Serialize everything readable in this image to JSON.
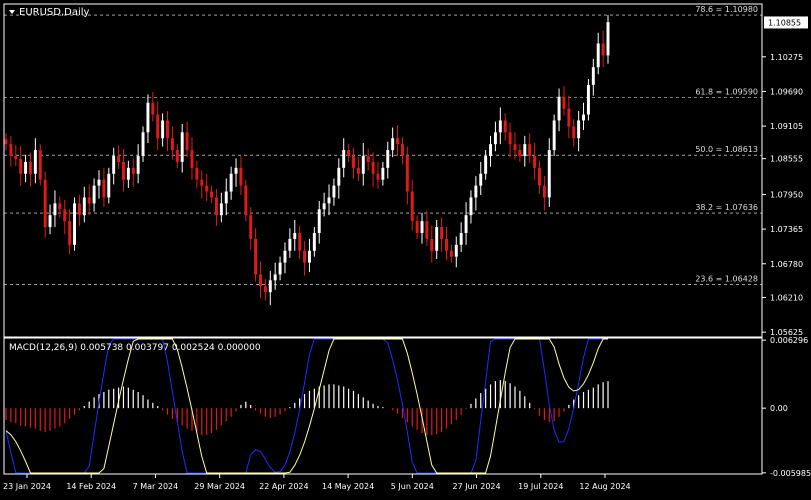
{
  "title": "EURUSD,Daily",
  "indicator_label": "MACD(12,26,9) 0.005738 0.003797 0.002524 0.000000",
  "colors": {
    "background": "#000000",
    "grid": "#ffffff",
    "bull": "#ffffff",
    "bear": "#e01a1a",
    "macd_line": "#1e2cff",
    "signal_line": "#ffff99",
    "hist_pos": "#ffffff",
    "hist_neg": "#e01a1a",
    "price_box_bg": "#ffffff",
    "price_box_fg": "#000000"
  },
  "chart_data": [
    {
      "type": "candlestick",
      "symbol": "EURUSD",
      "timeframe": "Daily",
      "ylim": [
        1.0556,
        1.1115
      ],
      "price_ticks": [
        "1.10275",
        "1.09690",
        "1.09105",
        "1.08555",
        "1.07950",
        "1.07365",
        "1.06780",
        "1.06210",
        "1.05625"
      ],
      "current_price": "1.10855",
      "fib_levels": [
        {
          "label": "78.6 = 1.10980",
          "value": 1.1098
        },
        {
          "label": "61.8 = 1.09590",
          "value": 1.0959
        },
        {
          "label": "50.0 = 1.08613",
          "value": 1.08613
        },
        {
          "label": "38.2 = 1.07636",
          "value": 1.07636
        },
        {
          "label": "23.6 = 1.06428",
          "value": 1.06428
        }
      ],
      "date_ticks": [
        "23 Jan 2024",
        "14 Feb 2024",
        "7 Mar 2024",
        "29 Mar 2024",
        "22 Apr 2024",
        "14 May 2024",
        "5 Jun 2024",
        "27 Jun 2024",
        "19 Jul 2024",
        "12 Aug 2024"
      ],
      "closes": [
        1.088,
        1.086,
        1.0855,
        1.083,
        1.085,
        1.083,
        1.087,
        1.082,
        1.074,
        1.076,
        1.078,
        1.077,
        1.075,
        1.071,
        1.078,
        1.076,
        1.079,
        1.078,
        1.081,
        1.082,
        1.079,
        1.083,
        1.086,
        1.085,
        1.082,
        1.084,
        1.083,
        1.086,
        1.09,
        1.095,
        1.093,
        1.089,
        1.092,
        1.089,
        1.087,
        1.085,
        1.09,
        1.087,
        1.084,
        1.082,
        1.081,
        1.08,
        1.079,
        1.076,
        1.078,
        1.08,
        1.083,
        1.084,
        1.081,
        1.076,
        1.072,
        1.066,
        1.064,
        1.063,
        1.065,
        1.066,
        1.068,
        1.07,
        1.072,
        1.073,
        1.07,
        1.068,
        1.07,
        1.073,
        1.077,
        1.078,
        1.079,
        1.081,
        1.084,
        1.087,
        1.086,
        1.084,
        1.083,
        1.086,
        1.085,
        1.083,
        1.082,
        1.084,
        1.087,
        1.089,
        1.088,
        1.086,
        1.08,
        1.075,
        1.073,
        1.075,
        1.072,
        1.07,
        1.074,
        1.072,
        1.07,
        1.069,
        1.071,
        1.073,
        1.076,
        1.079,
        1.081,
        1.083,
        1.086,
        1.088,
        1.09,
        1.092,
        1.09,
        1.088,
        1.087,
        1.086,
        1.088,
        1.086,
        1.084,
        1.081,
        1.079,
        1.087,
        1.092,
        1.096,
        1.094,
        1.091,
        1.089,
        1.092,
        1.093,
        1.098,
        1.101,
        1.105,
        1.103,
        1.1086
      ],
      "macd_range": [
        -0.006,
        0.0064
      ],
      "macd_ticks": [
        "0.006296",
        "0.00",
        "-0.005985"
      ],
      "histogram": [
        -0.0011,
        -0.0013,
        -0.0014,
        -0.0016,
        -0.0017,
        -0.0018,
        -0.0019,
        -0.0021,
        -0.0022,
        -0.0021,
        -0.0019,
        -0.0017,
        -0.0014,
        -0.001,
        -0.0006,
        -0.0002,
        0.0002,
        0.0006,
        0.001,
        0.0013,
        0.0015,
        0.0017,
        0.0018,
        0.0019,
        0.002,
        0.0019,
        0.0017,
        0.0015,
        0.0012,
        0.0008,
        0.0005,
        0.0002,
        -0.0002,
        -0.0006,
        -0.001,
        -0.0013,
        -0.0016,
        -0.0019,
        -0.0021,
        -0.0023,
        -0.0025,
        -0.0025,
        -0.0023,
        -0.002,
        -0.0016,
        -0.0012,
        -0.0008,
        -0.0003,
        0.0003,
        0.0006,
        0.0003,
        -0.0002,
        -0.0005,
        -0.0008,
        -0.0009,
        -0.0008,
        -0.0006,
        -0.0003,
        0.0001,
        0.0005,
        0.0009,
        0.0013,
        0.0016,
        0.0018,
        0.002,
        0.0021,
        0.0022,
        0.0022,
        0.0021,
        0.002,
        0.0018,
        0.0016,
        0.0013,
        0.001,
        0.0007,
        0.0004,
        0.0002,
        0.0001,
        0.0,
        -0.0002,
        -0.0005,
        -0.0009,
        -0.0013,
        -0.0017,
        -0.002,
        -0.0023,
        -0.0025,
        -0.0025,
        -0.0024,
        -0.0022,
        -0.0019,
        -0.0015,
        -0.0011,
        -0.0006,
        -0.0001,
        0.0004,
        0.0009,
        0.0014,
        0.0018,
        0.0022,
        0.0025,
        0.0026,
        0.0025,
        0.0023,
        0.002,
        0.0016,
        0.0011,
        0.0005,
        -0.0001,
        -0.0007,
        -0.0011,
        -0.0013,
        -0.0012,
        -0.0008,
        -0.0003,
        0.0003,
        0.0008,
        0.0012,
        0.0015,
        0.0017,
        0.0019,
        0.0022,
        0.0024,
        0.0025
      ]
    }
  ]
}
